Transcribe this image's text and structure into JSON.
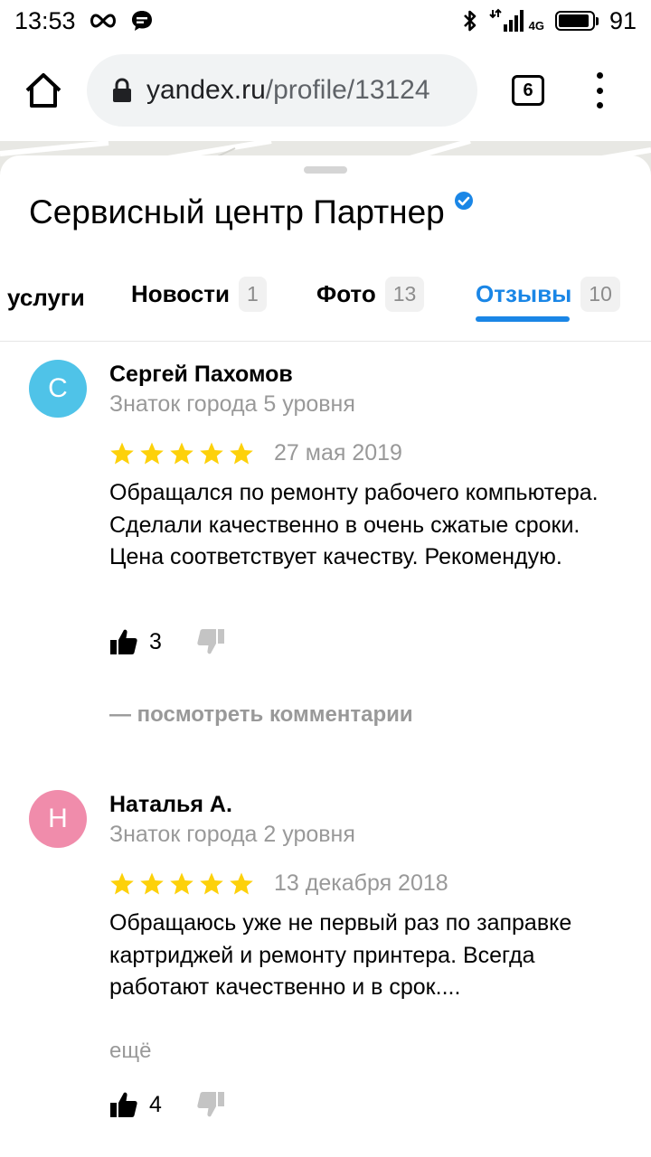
{
  "status_bar": {
    "time": "13:53",
    "network": "4G",
    "battery": "91",
    "battery_level": 0.91
  },
  "browser": {
    "url_host": "yandex.ru",
    "url_path": "/profile/13124",
    "tab_count": "6"
  },
  "business": {
    "name": "Сервисный центр Партнер"
  },
  "tabs": [
    {
      "label": "услуги",
      "count": ""
    },
    {
      "label": "Новости",
      "count": "1"
    },
    {
      "label": "Фото",
      "count": "13"
    },
    {
      "label": "Отзывы",
      "count": "10",
      "active": true
    }
  ],
  "reviews": [
    {
      "initial": "С",
      "avatar_color": "#4fc3e8",
      "author": "Сергей Пахомов",
      "level": "Знаток города 5 уровня",
      "stars": 5,
      "date": "27 мая 2019",
      "text": "Обращался по ремонту рабочего компьютера. Сделали качественно в очень сжатые сроки. Цена соответствует качеству. Рекомендую.",
      "likes": "3",
      "comments_link": "— посмотреть комментарии"
    },
    {
      "initial": "Н",
      "avatar_color": "#f08cab",
      "author": "Наталья А.",
      "level": "Знаток города 2 уровня",
      "stars": 5,
      "date": "13 декабря 2018",
      "text": "Обращаюсь уже не первый раз по заправке картриджей и ремонту принтера. Всегда работают качественно и в срок....",
      "more": "ещё",
      "likes": "4"
    }
  ],
  "colors": {
    "accent": "#1a86e6",
    "star": "#fdd10a",
    "muted": "#999999"
  }
}
